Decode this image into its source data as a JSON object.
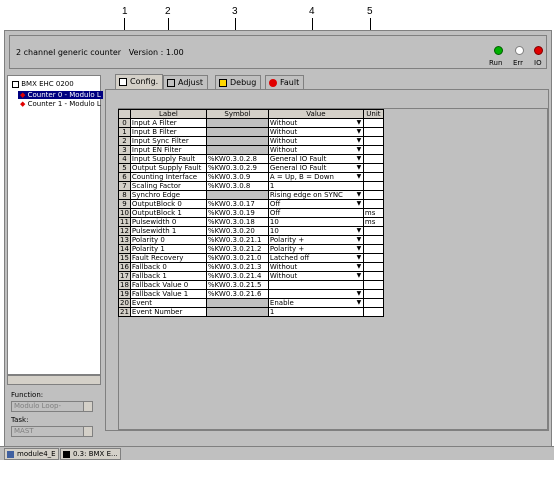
{
  "callouts": [
    "1",
    "2",
    "3",
    "4",
    "5"
  ],
  "header": {
    "title": "2 channel generic counter",
    "version": "Version : 1.00",
    "leds": [
      {
        "label": "Run",
        "color": "#00b000"
      },
      {
        "label": "Err",
        "color": "#ffffff"
      },
      {
        "label": "IO",
        "color": "#e00000"
      }
    ]
  },
  "sidebar": {
    "root": "BMX EHC 0200",
    "items": [
      "Counter 0 - Modulo L",
      "Counter 1 - Modulo L"
    ],
    "function_label": "Function:",
    "function_value": "Modulo Loop-",
    "task_label": "Task:",
    "task_value": "MAST"
  },
  "tabs": [
    "Config.",
    "Adjust",
    "Debug",
    "Fault"
  ],
  "table": {
    "headers": [
      "Label",
      "Symbol",
      "Value",
      "Unit"
    ],
    "rows": [
      {
        "idx": "0",
        "label": "Input A Filter",
        "symbol": "",
        "value": "Without",
        "unit": "",
        "dd": true
      },
      {
        "idx": "1",
        "label": "Input B Filter",
        "symbol": "",
        "value": "Without",
        "unit": "",
        "dd": true
      },
      {
        "idx": "2",
        "label": "Input Sync Filter",
        "symbol": "",
        "value": "Without",
        "unit": "",
        "dd": true
      },
      {
        "idx": "3",
        "label": "Input EN Filter",
        "symbol": "",
        "value": "Without",
        "unit": "",
        "dd": true
      },
      {
        "idx": "4",
        "label": "Input Supply Fault",
        "symbol": "%KW0.3.0.2.8",
        "value": "General IO Fault",
        "unit": "",
        "dd": true
      },
      {
        "idx": "5",
        "label": "Output Supply Fault",
        "symbol": "%KW0.3.0.2.9",
        "value": "General IO Fault",
        "unit": "",
        "dd": true
      },
      {
        "idx": "6",
        "label": "Counting Interface",
        "symbol": "%KW0.3.0.9",
        "value": "A = Up, B = Down",
        "unit": "",
        "dd": true
      },
      {
        "idx": "7",
        "label": "Scaling Factor",
        "symbol": "%KW0.3.0.8",
        "value": "1",
        "unit": "",
        "dd": false
      },
      {
        "idx": "8",
        "label": "Synchro Edge",
        "symbol": "",
        "value": "Rising edge on SYNC",
        "unit": "",
        "dd": true
      },
      {
        "idx": "9",
        "label": "OutputBlock 0",
        "symbol": "%KW0.3.0.17",
        "value": "Off",
        "unit": "",
        "dd": true
      },
      {
        "idx": "10",
        "label": "OutputBlock 1",
        "symbol": "%KW0.3.0.19",
        "value": "Off",
        "unit": "ms",
        "dd": false
      },
      {
        "idx": "11",
        "label": "Pulsewidth 0",
        "symbol": "%KW0.3.0.18",
        "value": "10",
        "unit": "ms",
        "dd": false
      },
      {
        "idx": "12",
        "label": "Pulsewidth 1",
        "symbol": "%KW0.3.0.20",
        "value": "10",
        "unit": "",
        "dd": true
      },
      {
        "idx": "13",
        "label": "Polarity 0",
        "symbol": "%KW0.3.0.21.1",
        "value": "Polarity +",
        "unit": "",
        "dd": true
      },
      {
        "idx": "14",
        "label": "Polarity 1",
        "symbol": "%KW0.3.0.21.2",
        "value": "Polarity +",
        "unit": "",
        "dd": true
      },
      {
        "idx": "15",
        "label": "Fault Recovery",
        "symbol": "%KW0.3.0.21.0",
        "value": "Latched off",
        "unit": "",
        "dd": true
      },
      {
        "idx": "16",
        "label": "Fallback 0",
        "symbol": "%KW0.3.0.21.3",
        "value": "Without",
        "unit": "",
        "dd": true
      },
      {
        "idx": "17",
        "label": "Fallback 1",
        "symbol": "%KW0.3.0.21.4",
        "value": "Without",
        "unit": "",
        "dd": true
      },
      {
        "idx": "18",
        "label": "Fallback Value 0",
        "symbol": "%KW0.3.0.21.5",
        "value": "",
        "unit": "",
        "dd": false
      },
      {
        "idx": "19",
        "label": "Fallback Value 1",
        "symbol": "%KW0.3.0.21.6",
        "value": "",
        "unit": "",
        "dd": true
      },
      {
        "idx": "20",
        "label": "Event",
        "symbol": "",
        "value": "Enable",
        "unit": "",
        "dd": true
      },
      {
        "idx": "21",
        "label": "Event Number",
        "symbol": "",
        "value": "1",
        "unit": "",
        "dd": false
      }
    ]
  },
  "taskbar": [
    "module4_E",
    "0.3: BMX E..."
  ]
}
